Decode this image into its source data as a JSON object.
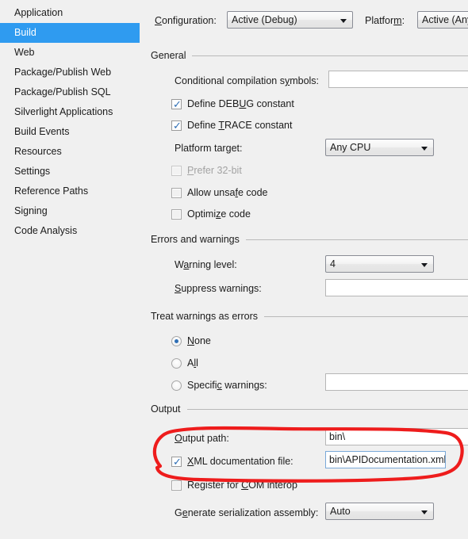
{
  "sidebar": {
    "items": [
      {
        "label": "Application",
        "selected": false
      },
      {
        "label": "Build",
        "selected": true
      },
      {
        "label": "Web",
        "selected": false
      },
      {
        "label": "Package/Publish Web",
        "selected": false
      },
      {
        "label": "Package/Publish SQL",
        "selected": false
      },
      {
        "label": "Silverlight Applications",
        "selected": false
      },
      {
        "label": "Build Events",
        "selected": false
      },
      {
        "label": "Resources",
        "selected": false
      },
      {
        "label": "Settings",
        "selected": false
      },
      {
        "label": "Reference Paths",
        "selected": false
      },
      {
        "label": "Signing",
        "selected": false
      },
      {
        "label": "Code Analysis",
        "selected": false
      }
    ]
  },
  "topbar": {
    "configuration_label": "Configuration:",
    "configuration_value": "Active (Debug)",
    "platform_label": "Platform:",
    "platform_value": "Active (Any"
  },
  "sections": {
    "general": "General",
    "errors_and_warnings": "Errors and warnings",
    "treat_warnings_as_errors": "Treat warnings as errors",
    "output": "Output"
  },
  "general": {
    "conditional_symbols_label": "Conditional compilation symbols:",
    "conditional_symbols_value": "",
    "define_debug_label": "Define DEBUG constant",
    "define_debug_checked": true,
    "define_trace_label": "Define TRACE constant",
    "define_trace_checked": true,
    "platform_target_label": "Platform target:",
    "platform_target_value": "Any CPU",
    "prefer_32bit_label": "Prefer 32-bit",
    "prefer_32bit_checked": false,
    "prefer_32bit_disabled": true,
    "allow_unsafe_label": "Allow unsafe code",
    "allow_unsafe_checked": false,
    "optimize_label": "Optimize code",
    "optimize_checked": false
  },
  "errors": {
    "warning_level_label": "Warning level:",
    "warning_level_value": "4",
    "suppress_warnings_label": "Suppress warnings:",
    "suppress_warnings_value": ""
  },
  "treat": {
    "none_label": "None",
    "all_label": "All",
    "specific_label": "Specific warnings:",
    "specific_value": "",
    "selected": "None"
  },
  "output": {
    "output_path_label": "Output path:",
    "output_path_value": "bin\\",
    "xml_doc_label": "XML documentation file:",
    "xml_doc_checked": true,
    "xml_doc_value": "bin\\APIDocumentation.xml",
    "register_com_label": "Register for COM interop",
    "register_com_checked": false,
    "serialization_label": "Generate serialization assembly:",
    "serialization_value": "Auto"
  },
  "annotation": {
    "shape": "hand-drawn-red-ellipse",
    "color": "#ee1c1c",
    "encircles": "XML documentation file row"
  },
  "colors": {
    "background": "#f0f0f0",
    "selection": "#2f9bf0",
    "annotation_red": "#ee1c1c",
    "check_blue": "#2f6fb5"
  },
  "icons": {
    "caret": "▼",
    "tick": "✓"
  }
}
